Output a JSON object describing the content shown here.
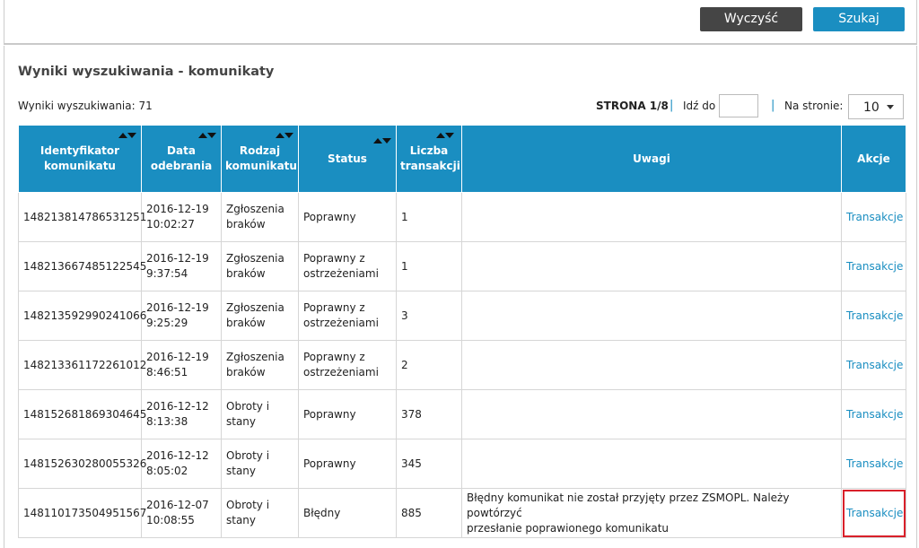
{
  "toolbar": {
    "clear_label": "Wyczyść",
    "search_label": "Szukaj"
  },
  "results": {
    "title": "Wyniki wyszukiwania - komunikaty",
    "count_label": "Wyniki wyszukiwania: 71"
  },
  "pager": {
    "page_label": "STRONA 1/8",
    "separator": "|",
    "goto_label": "Idź do",
    "goto_value": "",
    "per_page_label": "Na stronie:",
    "per_page_value": "10"
  },
  "table": {
    "columns": [
      {
        "line1": "Identyfikator",
        "line2": "komunikatu",
        "sortable": true
      },
      {
        "line1": "Data",
        "line2": "odebrania",
        "sortable": true
      },
      {
        "line1": "Rodzaj",
        "line2": "komunikatu",
        "sortable": true
      },
      {
        "line1": "Status",
        "line2": "",
        "sortable": true
      },
      {
        "line1": "Liczba",
        "line2": "transakcji",
        "sortable": true
      },
      {
        "line1": "Uwagi",
        "line2": "",
        "sortable": false
      },
      {
        "line1": "Akcje",
        "line2": "",
        "sortable": false
      }
    ],
    "rows": [
      {
        "id": "148213814786531251",
        "date": "2016-12-19",
        "time": "10:02:27",
        "type1": "Zgłoszenia",
        "type2": "braków",
        "status1": "Poprawny",
        "status2": "",
        "count": "1",
        "notes1": "",
        "notes2": "",
        "action": "Transakcje"
      },
      {
        "id": "148213667485122545",
        "date": "2016-12-19",
        "time": "9:37:54",
        "type1": "Zgłoszenia",
        "type2": "braków",
        "status1": "Poprawny z",
        "status2": "ostrzeżeniami",
        "count": "1",
        "notes1": "",
        "notes2": "",
        "action": "Transakcje"
      },
      {
        "id": "148213592990241066",
        "date": "2016-12-19",
        "time": "9:25:29",
        "type1": "Zgłoszenia",
        "type2": "braków",
        "status1": "Poprawny z",
        "status2": "ostrzeżeniami",
        "count": "3",
        "notes1": "",
        "notes2": "",
        "action": "Transakcje"
      },
      {
        "id": "148213361172261012",
        "date": "2016-12-19",
        "time": "8:46:51",
        "type1": "Zgłoszenia",
        "type2": "braków",
        "status1": "Poprawny z",
        "status2": "ostrzeżeniami",
        "count": "2",
        "notes1": "",
        "notes2": "",
        "action": "Transakcje"
      },
      {
        "id": "148152681869304645",
        "date": "2016-12-12",
        "time": "8:13:38",
        "type1": "Obroty i",
        "type2": "stany",
        "status1": "Poprawny",
        "status2": "",
        "count": "378",
        "notes1": "",
        "notes2": "",
        "action": "Transakcje"
      },
      {
        "id": "148152630280055326",
        "date": "2016-12-12",
        "time": "8:05:02",
        "type1": "Obroty i",
        "type2": "stany",
        "status1": "Poprawny",
        "status2": "",
        "count": "345",
        "notes1": "",
        "notes2": "",
        "action": "Transakcje"
      },
      {
        "id": "148110173504951567",
        "date": "2016-12-07",
        "time": "10:08:55",
        "type1": "Obroty i",
        "type2": "stany",
        "status1": "Błędny",
        "status2": "",
        "count": "885",
        "notes1": "Błędny komunikat nie został przyjęty przez ZSMOPL. Należy powtórzyć",
        "notes2": "przesłanie poprawionego komunikatu",
        "action": "Transakcje"
      }
    ]
  }
}
